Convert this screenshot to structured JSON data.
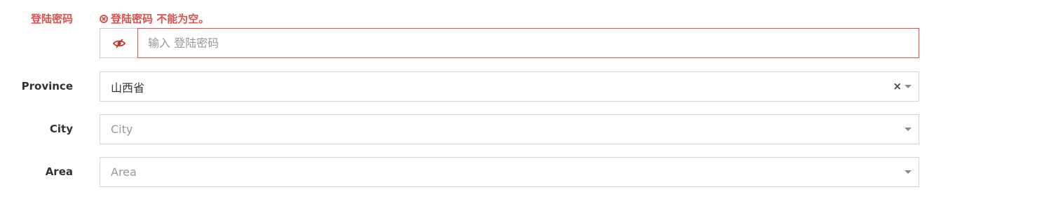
{
  "password": {
    "label": "登陆密码",
    "error_message": "登陆密码 不能为空。",
    "placeholder": "输入 登陆密码",
    "value": "",
    "accent_color": "#d9534f"
  },
  "province": {
    "label": "Province",
    "selected": "山西省",
    "clear_symbol": "×"
  },
  "city": {
    "label": "City",
    "placeholder": "City"
  },
  "area": {
    "label": "Area",
    "placeholder": "Area"
  }
}
